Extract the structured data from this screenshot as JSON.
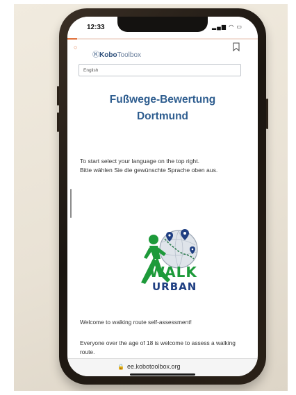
{
  "status_bar": {
    "time": "12:33",
    "icons": "▂▄▆ ◠ ▭"
  },
  "progress": {
    "fraction": 0.05
  },
  "header": {
    "logo_mark": "Ⓚ",
    "logo_bold": "Kobo",
    "logo_light": "Toolbox"
  },
  "language_select": {
    "value": "English"
  },
  "form": {
    "title_line1": "Fußwege-Bewertung",
    "title_line2": "Dortmund",
    "intro_en": "To start select your language on the top right.",
    "intro_de": "Bitte wählen Sie die gewünschte Sprache oben aus.",
    "logo_walk": "WALK",
    "logo_urban": "URBAN",
    "welcome": "Welcome to walking route self-assessment!",
    "everyone": "Everyone over the age of 18 is welcome to assess a walking route."
  },
  "browser": {
    "lock_icon": "🔒",
    "url": "ee.kobotoolbox.org"
  },
  "colors": {
    "accent": "#e0703a",
    "title_blue": "#2e5d8f",
    "walk_green": "#1d9a3a",
    "urban_blue": "#1f3f82"
  }
}
